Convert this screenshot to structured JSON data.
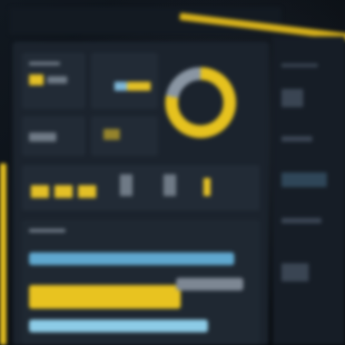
{
  "app": {
    "title": ""
  },
  "colors": {
    "accent_yellow": "#e8c320",
    "accent_blue": "#7fc2e0",
    "panel_dark": "#1b232d",
    "background": "#0c1016"
  },
  "donut": {
    "primary_fraction": 0.78,
    "primary_color": "#e6c21e",
    "secondary_color": "#8a96a3"
  },
  "bars": [
    {
      "name": "bar-blue-top",
      "fraction": 0.92,
      "color": "#5fa8cf"
    },
    {
      "name": "bar-yellow",
      "fraction": 0.68,
      "color": "#e8c320"
    },
    {
      "name": "bar-grey",
      "fraction": 0.3,
      "color": "#7d8793"
    },
    {
      "name": "bar-blue-bottom",
      "fraction": 0.8,
      "color": "#8ccbe6"
    }
  ]
}
